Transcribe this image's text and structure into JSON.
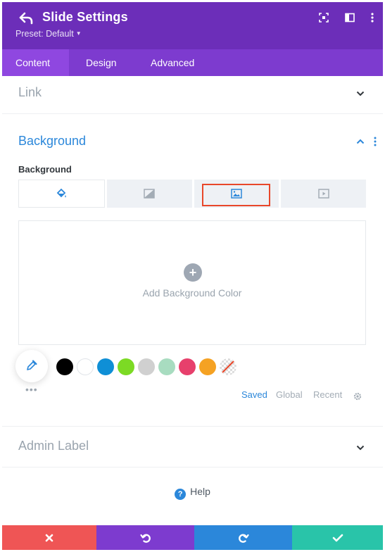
{
  "header": {
    "title": "Slide Settings",
    "preset_label": "Preset: Default",
    "icons": [
      "back-arrow-icon",
      "expand-icon",
      "sidebar-icon",
      "more-vertical-icon"
    ],
    "background_color": "#6c2eb9"
  },
  "tabs": [
    {
      "label": "Content",
      "active": true
    },
    {
      "label": "Design",
      "active": false
    },
    {
      "label": "Advanced",
      "active": false
    }
  ],
  "sections": {
    "link": {
      "title": "Link",
      "expanded": false
    },
    "background": {
      "title": "Background",
      "expanded": true,
      "field_label": "Background",
      "type_tabs": [
        {
          "icon": "paint-bucket-icon",
          "active": true
        },
        {
          "icon": "gradient-icon",
          "active": false
        },
        {
          "icon": "image-icon",
          "active": false,
          "highlighted": true
        },
        {
          "icon": "video-icon",
          "active": false
        }
      ],
      "add_color_text": "Add Background Color",
      "swatches": [
        "#000000",
        "#ffffff",
        "#0f8fd6",
        "#7cda24",
        "#d0d0d0",
        "#a8dcc0",
        "#e7406c",
        "#f5a223",
        "transparent"
      ],
      "palette_tabs": [
        {
          "label": "Saved",
          "active": true
        },
        {
          "label": "Global",
          "active": false
        },
        {
          "label": "Recent",
          "active": false
        }
      ]
    },
    "admin_label": {
      "title": "Admin Label",
      "expanded": false
    }
  },
  "help_label": "Help",
  "bottom_bar": {
    "buttons": [
      {
        "action": "cancel",
        "icon": "close-icon",
        "color": "#ef5555"
      },
      {
        "action": "undo",
        "icon": "undo-icon",
        "color": "#7d3bcf"
      },
      {
        "action": "redo",
        "icon": "redo-icon",
        "color": "#2b87da"
      },
      {
        "action": "save",
        "icon": "checkmark-icon",
        "color": "#29c4a9"
      }
    ]
  },
  "colors": {
    "accent_blue": "#2b87da",
    "highlight_red": "#e8472a"
  }
}
